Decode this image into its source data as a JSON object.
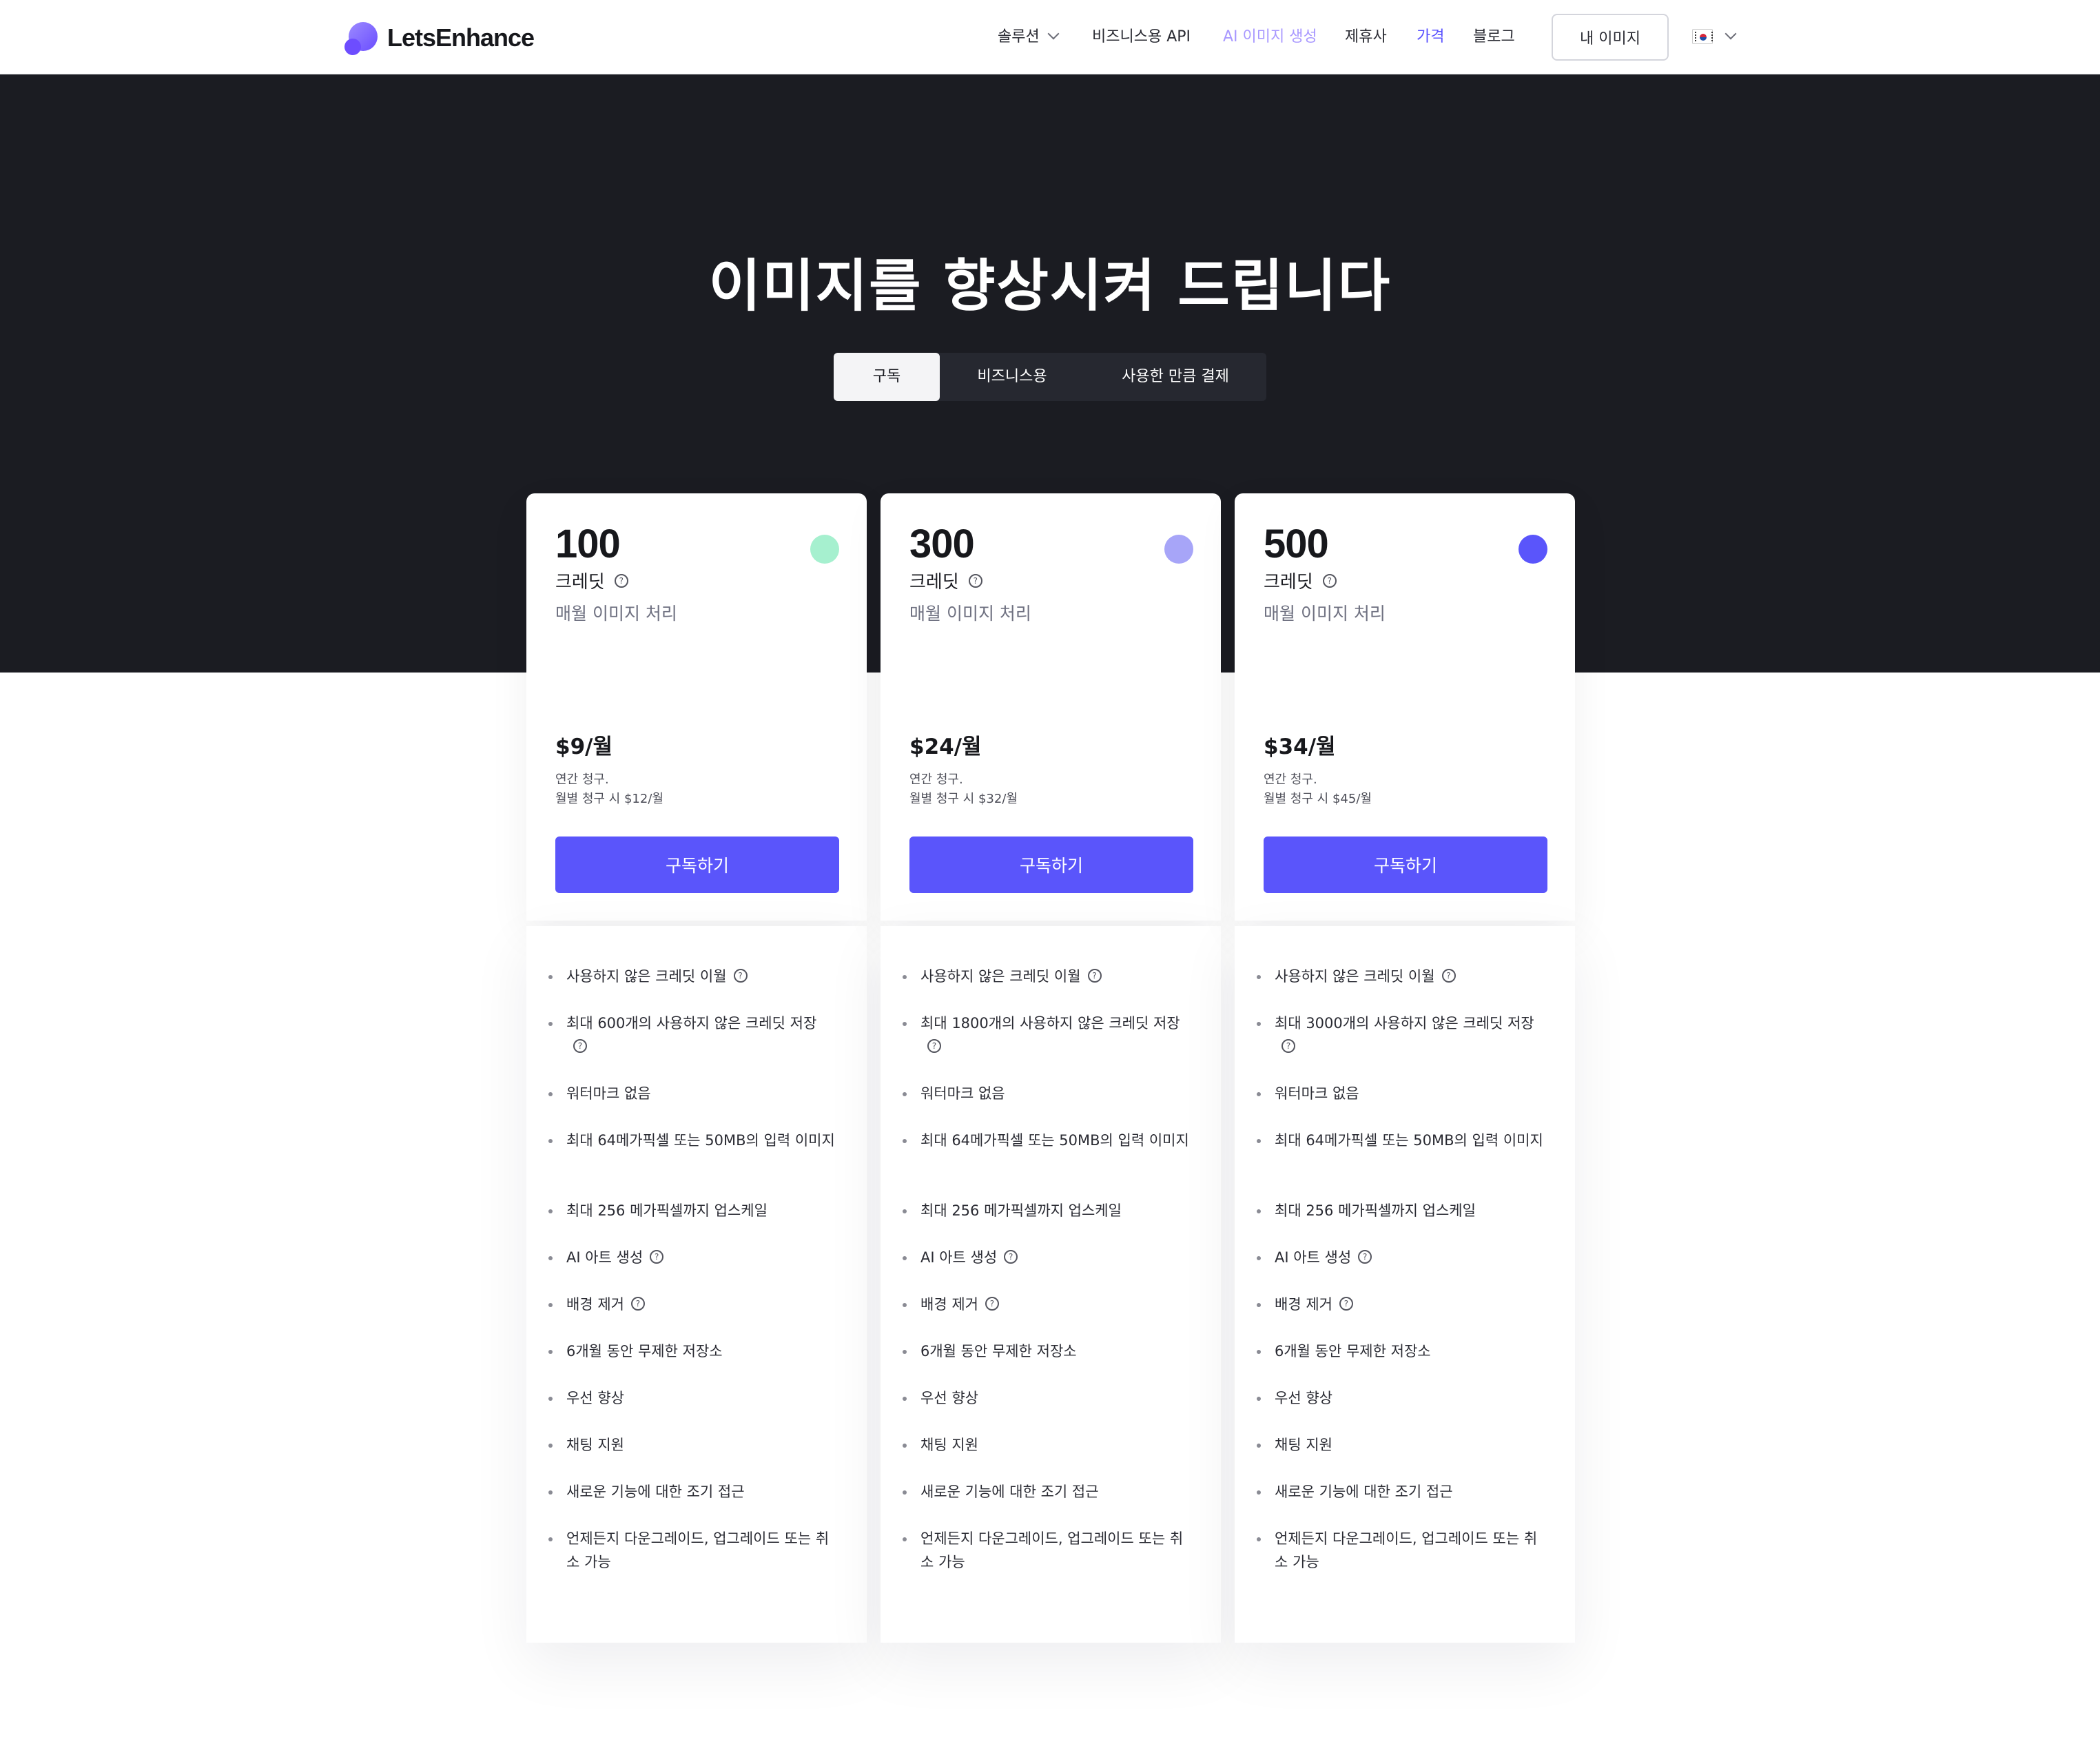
{
  "nav": {
    "logo_text": "LetsEnhance",
    "items": [
      {
        "label": "솔루션"
      },
      {
        "label": "비즈니스용 API"
      },
      {
        "label": "AI 이미지 생성"
      },
      {
        "label": "제휴사"
      },
      {
        "label": "가격"
      },
      {
        "label": "블로그"
      }
    ],
    "my_images_button": "내 이미지"
  },
  "hero": {
    "title": "이미지를 향상시켜 드립니다",
    "tabs": [
      "구독",
      "비즈니스용",
      "사용한 만큼 결제"
    ]
  },
  "colors": {
    "accent": "#5a55fb",
    "hero_bg": "#1b1c22",
    "dot_100": "#a6f0cf",
    "dot_300": "#a7a5f8",
    "dot_500": "#5a55fb"
  },
  "plans": [
    {
      "credits": "100",
      "credits_label": "크레딧",
      "monthly_label": "매월 이미지 처리",
      "price": "$9/월",
      "billing_line1": "연간 청구.",
      "billing_line2": "월별 청구 시 $12/월",
      "button": "구독하기",
      "features": [
        "사용하지 않은 크레딧 이월",
        "최대 600개의 사용하지 않은 크레딧 저장",
        "워터마크 없음",
        "최대 64메가픽셀 또는 50MB의 입력 이미지",
        "최대 256 메가픽셀까지 업스케일",
        "AI 아트 생성",
        "배경 제거",
        "6개월 동안 무제한 저장소",
        "우선 향상",
        "채팅 지원",
        "새로운 기능에 대한 조기 접근",
        "언제든지 다운그레이드, 업그레이드 또는 취소 가능"
      ]
    },
    {
      "credits": "300",
      "credits_label": "크레딧",
      "monthly_label": "매월 이미지 처리",
      "price": "$24/월",
      "billing_line1": "연간 청구.",
      "billing_line2": "월별 청구 시 $32/월",
      "button": "구독하기",
      "features": [
        "사용하지 않은 크레딧 이월",
        "최대 1800개의 사용하지 않은 크레딧 저장",
        "워터마크 없음",
        "최대 64메가픽셀 또는 50MB의 입력 이미지",
        "최대 256 메가픽셀까지 업스케일",
        "AI 아트 생성",
        "배경 제거",
        "6개월 동안 무제한 저장소",
        "우선 향상",
        "채팅 지원",
        "새로운 기능에 대한 조기 접근",
        "언제든지 다운그레이드, 업그레이드 또는 취소 가능"
      ]
    },
    {
      "credits": "500",
      "credits_label": "크레딧",
      "monthly_label": "매월 이미지 처리",
      "price": "$34/월",
      "billing_line1": "연간 청구.",
      "billing_line2": "월별 청구 시 $45/월",
      "button": "구독하기",
      "features": [
        "사용하지 않은 크레딧 이월",
        "최대 3000개의 사용하지 않은 크레딧 저장",
        "워터마크 없음",
        "최대 64메가픽셀 또는 50MB의 입력 이미지",
        "최대 256 메가픽셀까지 업스케일",
        "AI 아트 생성",
        "배경 제거",
        "6개월 동안 무제한 저장소",
        "우선 향상",
        "채팅 지원",
        "새로운 기능에 대한 조기 접근",
        "언제든지 다운그레이드, 업그레이드 또는 취소 가능"
      ]
    }
  ]
}
